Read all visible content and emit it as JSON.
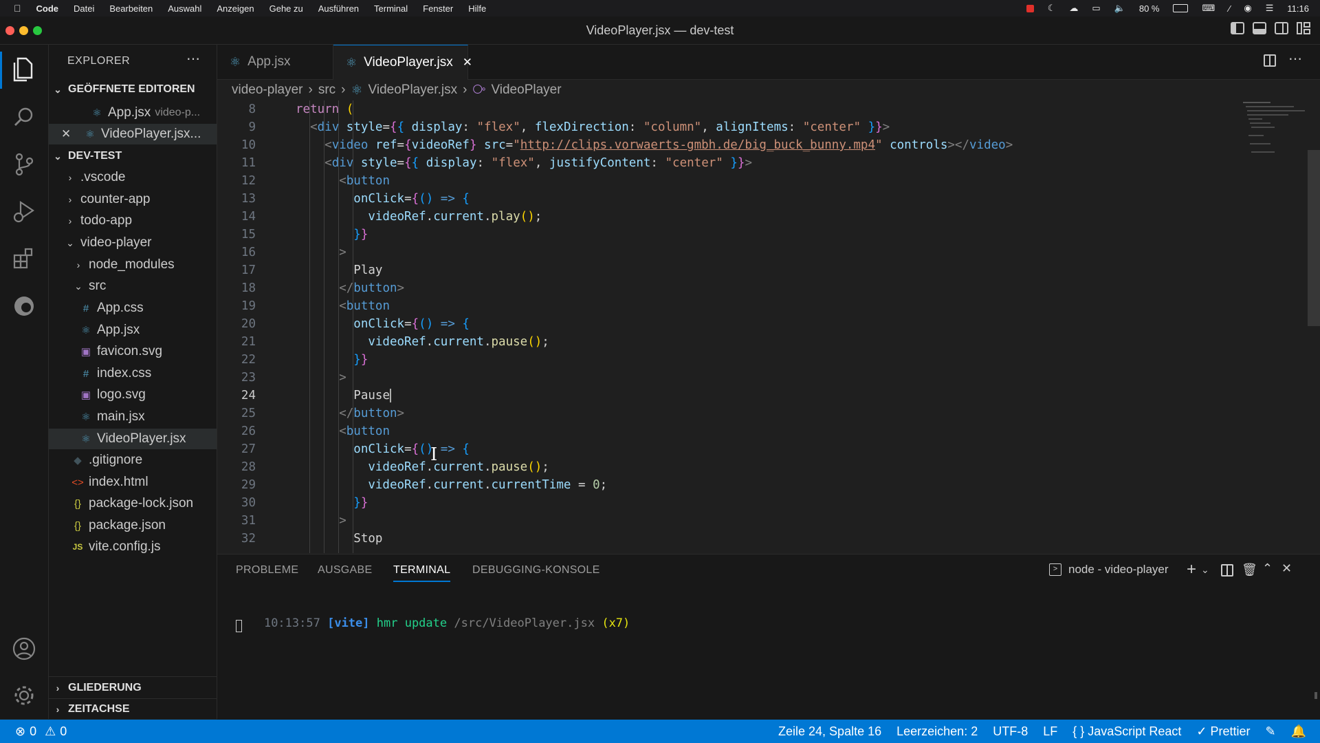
{
  "menubar": {
    "items": [
      "Code",
      "Datei",
      "Bearbeiten",
      "Auswahl",
      "Anzeigen",
      "Gehe zu",
      "Ausführen",
      "Terminal",
      "Fenster",
      "Hilfe"
    ],
    "battery": "80 %",
    "time": "11:16"
  },
  "window": {
    "title": "VideoPlayer.jsx — dev-test"
  },
  "sidebar": {
    "header": "EXPLORER",
    "open_editors_title": "GEÖFFNETE EDITOREN",
    "open_editors": [
      {
        "name": "App.jsx",
        "desc": "video-p..."
      },
      {
        "name": "VideoPlayer.jsx..."
      }
    ],
    "workspace_title": "DEV-TEST",
    "tree": [
      {
        "name": ".vscode"
      },
      {
        "name": "counter-app"
      },
      {
        "name": "todo-app"
      },
      {
        "name": "video-player"
      },
      {
        "name": "node_modules"
      },
      {
        "name": "src"
      },
      {
        "name": "App.css"
      },
      {
        "name": "App.jsx"
      },
      {
        "name": "favicon.svg"
      },
      {
        "name": "index.css"
      },
      {
        "name": "logo.svg"
      },
      {
        "name": "main.jsx"
      },
      {
        "name": "VideoPlayer.jsx"
      },
      {
        "name": ".gitignore"
      },
      {
        "name": "index.html"
      },
      {
        "name": "package-lock.json"
      },
      {
        "name": "package.json"
      },
      {
        "name": "vite.config.js"
      }
    ],
    "outline_title": "GLIEDERUNG",
    "timeline_title": "ZEITACHSE"
  },
  "tabs": [
    {
      "label": "App.jsx"
    },
    {
      "label": "VideoPlayer.jsx"
    }
  ],
  "breadcrumb": [
    "video-player",
    "src",
    "VideoPlayer.jsx",
    "VideoPlayer"
  ],
  "editor": {
    "line_numbers": [
      "8",
      "9",
      "10",
      "11",
      "12",
      "13",
      "14",
      "15",
      "16",
      "17",
      "18",
      "19",
      "20",
      "21",
      "22",
      "23",
      "24",
      "25",
      "26",
      "27",
      "28",
      "29",
      "30",
      "31",
      "32"
    ],
    "current_line": "24",
    "url": "http://clips.vorwaerts-gmbh.de/big_buck_bunny.mp4"
  },
  "panel": {
    "tabs": [
      "PROBLEME",
      "AUSGABE",
      "TERMINAL",
      "DEBUGGING-KONSOLE"
    ],
    "terminal_name": "node - video-player",
    "log": {
      "time": "10:13:57",
      "tag": "[vite]",
      "msg": "hmr update",
      "path": "/src/VideoPlayer.jsx",
      "count": "(x7)"
    }
  },
  "status": {
    "errors": "0",
    "warnings": "0",
    "position": "Zeile 24, Spalte 16",
    "spaces": "Leerzeichen: 2",
    "encoding": "UTF-8",
    "eol": "LF",
    "language": "JavaScript React",
    "formatter": "Prettier"
  },
  "colors": {
    "accent": "#0078d4",
    "bg": "#1f1f1f",
    "sidebar": "#181818"
  }
}
